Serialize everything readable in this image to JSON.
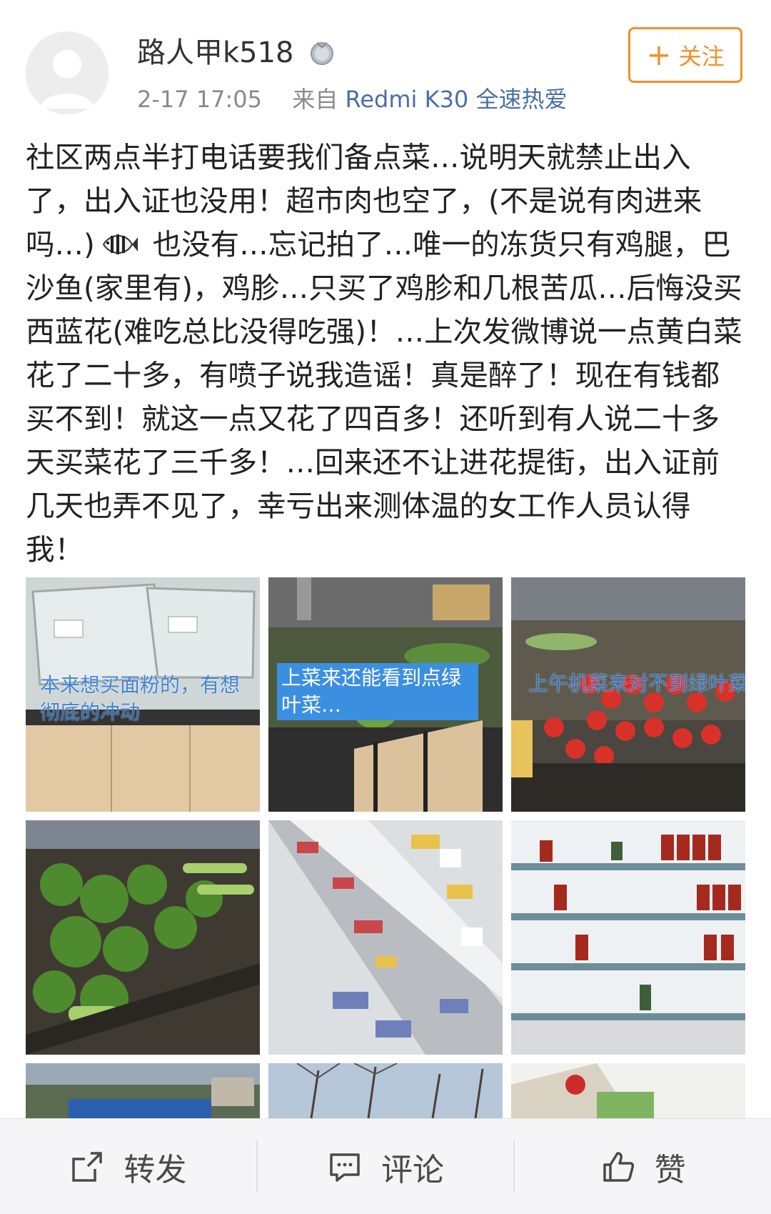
{
  "post": {
    "username": "路人甲k518",
    "timestamp": "2-17 17:05",
    "source_prefix": "来自",
    "source": "Redmi K30 全速热爱",
    "follow_label": "关注",
    "text_part1": "社区两点半打电话要我们备点菜…说明天就禁止出入了，出入证也没用！超市肉也空了，(不是说有肉进来吗…)",
    "text_part2": " 也没有…忘记拍了…唯一的冻货只有鸡腿，巴沙鱼(家里有)，鸡胗…只买了鸡胗和几根苦瓜…后悔没买西蓝花(难吃总比没得吃强)！…上次发微博说一点黄白菜花了二十多，有喷子说我造谣！真是醉了！现在有钱都买不到！就这一点又花了四百多！还听到有人说二十多天买菜花了三千多！…回来还不让进花提街，出入证前几天也弄不见了，幸亏出来测体温的女工作人员认得我！"
  },
  "images": {
    "captions": [
      "本来想买面粉的，有想彻底的冲动",
      "上菜来还能看到点绿叶菜…",
      "上午机菜来对不到绿叶菜"
    ]
  },
  "actions": {
    "repost": "转发",
    "comment": "评论",
    "like": "赞"
  },
  "colors": {
    "follow_orange": "#f2902d",
    "source_blue": "#4a6fa5",
    "caption_blue": "#3b8fe0"
  }
}
